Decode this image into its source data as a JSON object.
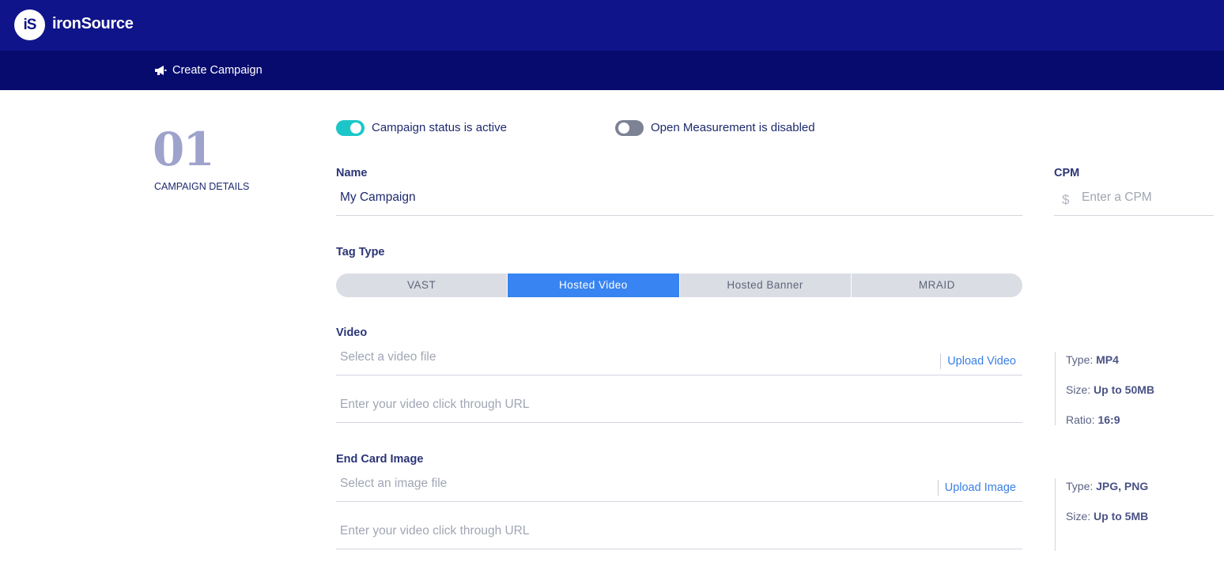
{
  "brand": {
    "logo_mark": "iS",
    "name": "ironSource"
  },
  "nav": {
    "item_label": "Create Campaign",
    "item_icon": "megaphone-icon"
  },
  "step": {
    "number": "01",
    "label": "CAMPAIGN DETAILS"
  },
  "toggles": {
    "campaign_status": {
      "label": "Campaign status is active",
      "on": true
    },
    "open_measurement": {
      "label": "Open Measurement is disabled",
      "on": false
    }
  },
  "name_field": {
    "label": "Name",
    "value": "My Campaign"
  },
  "cpm_field": {
    "label": "CPM",
    "prefix": "$",
    "placeholder": "Enter a CPM"
  },
  "tag_type": {
    "label": "Tag Type",
    "options": [
      "VAST",
      "Hosted Video",
      "Hosted Banner",
      "MRAID"
    ],
    "selected": "Hosted Video"
  },
  "video": {
    "label": "Video",
    "file_placeholder": "Select a video file",
    "upload_label": "Upload Video",
    "url_placeholder": "Enter your video click through URL",
    "specs": [
      {
        "key": "Type:",
        "value": "MP4"
      },
      {
        "key": "Size:",
        "value": "Up to 50MB"
      },
      {
        "key": "Ratio:",
        "value": "16:9"
      }
    ]
  },
  "end_card": {
    "label": "End Card Image",
    "file_placeholder": "Select an image file",
    "upload_label": "Upload Image",
    "url_placeholder": "Enter your video click through URL",
    "specs": [
      {
        "key": "Type:",
        "value": "JPG, PNG"
      },
      {
        "key": "Size:",
        "value": "Up to 5MB"
      }
    ]
  },
  "colors": {
    "header": "#10148a",
    "subheader": "#070b6e",
    "accent_toggle": "#1cc6c8",
    "accent_selected": "#3884f2",
    "link": "#3a7ee6"
  }
}
